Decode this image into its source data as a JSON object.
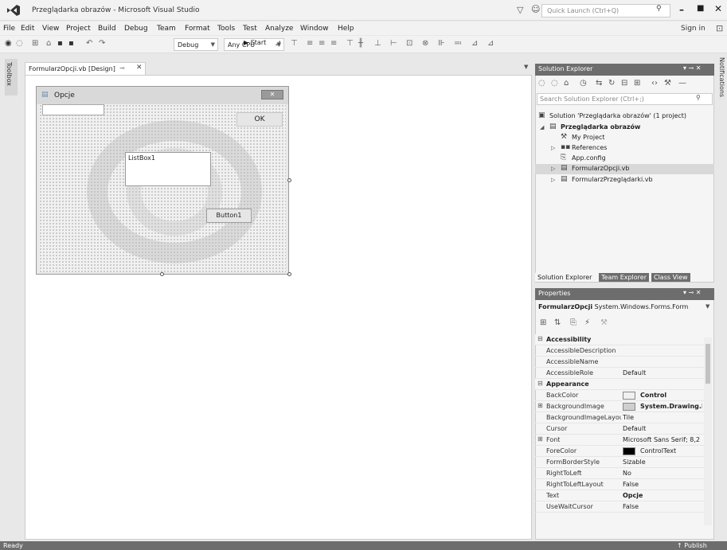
{
  "window": {
    "title": "Przeglądarka obrazów - Microsoft Visual Studio",
    "quick_launch_placeholder": "Quick Launch (Ctrl+Q)",
    "sign_in": "Sign in"
  },
  "menu": [
    "File",
    "Edit",
    "View",
    "Project",
    "Build",
    "Debug",
    "Team",
    "Format",
    "Tools",
    "Test",
    "Analyze",
    "Window",
    "Help"
  ],
  "toolbar": {
    "config": "Debug",
    "platform": "Any CPU",
    "start": "▶ Start"
  },
  "side": {
    "toolbox": "Toolbox",
    "notifications": "Notifications"
  },
  "document": {
    "tab_label": "FormularzOpcji.vb [Design]"
  },
  "form": {
    "title": "Opcje",
    "ok_label": "OK",
    "listbox_label": "ListBox1",
    "button1_label": "Button1"
  },
  "solution_explorer": {
    "title": "Solution Explorer",
    "search_placeholder": "Search Solution Explorer (Ctrl+;)",
    "items": [
      {
        "label": "Solution 'Przeglądarka obrazów' (1 project)"
      },
      {
        "label": "Przeglądarka obrazów"
      },
      {
        "label": "My Project"
      },
      {
        "label": "References"
      },
      {
        "label": "App.config"
      },
      {
        "label": "FormularzOpcji.vb"
      },
      {
        "label": "FormularzPrzeglądarki.vb"
      }
    ],
    "tabs": [
      "Solution Explorer",
      "Team Explorer",
      "Class View"
    ]
  },
  "properties": {
    "title": "Properties",
    "object_name": "FormularzOpcji",
    "object_type": "System.Windows.Forms.Form",
    "rows": [
      {
        "name": "Accessibility",
        "value": ""
      },
      {
        "name": "AccessibleDescription",
        "value": ""
      },
      {
        "name": "AccessibleName",
        "value": ""
      },
      {
        "name": "AccessibleRole",
        "value": "Default"
      },
      {
        "name": "Appearance",
        "value": ""
      },
      {
        "name": "BackColor",
        "value": "Control"
      },
      {
        "name": "BackgroundImage",
        "value": "System.Drawing.B"
      },
      {
        "name": "BackgroundImageLayout",
        "value": "Tile"
      },
      {
        "name": "Cursor",
        "value": "Default"
      },
      {
        "name": "Font",
        "value": "Microsoft Sans Serif; 8,2"
      },
      {
        "name": "ForeColor",
        "value": "ControlText"
      },
      {
        "name": "FormBorderStyle",
        "value": "Sizable"
      },
      {
        "name": "RightToLeft",
        "value": "No"
      },
      {
        "name": "RightToLeftLayout",
        "value": "False"
      },
      {
        "name": "Text",
        "value": "Opcje"
      },
      {
        "name": "UseWaitCursor",
        "value": "False"
      }
    ],
    "colors": {
      "backcolor_swatch": "#f0f0f0",
      "forecolor_swatch": "#000000",
      "bgimage_swatch": "#cfcfcf"
    }
  },
  "status": {
    "ready": "Ready",
    "publish": "↑ Publish"
  }
}
